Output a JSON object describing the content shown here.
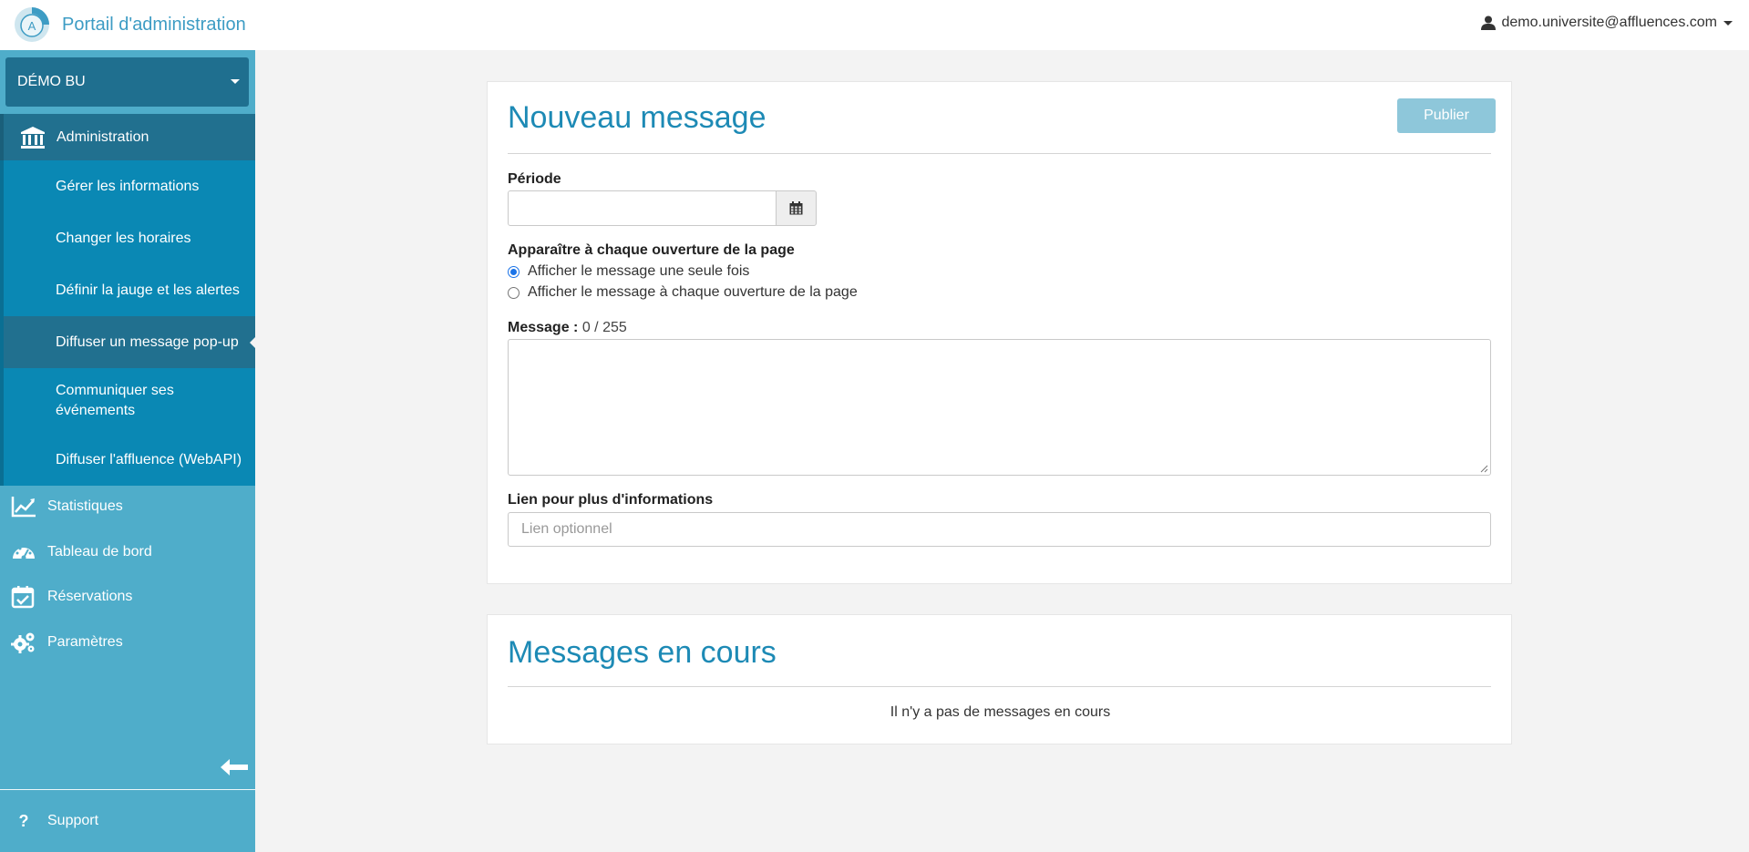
{
  "header": {
    "title": "Portail d'administration",
    "user_email": "demo.universite@affluences.com",
    "logo_letter": "A"
  },
  "sidebar": {
    "site_selector": "DÉMO BU",
    "admin_label": "Administration",
    "admin_items": [
      {
        "label": "Gérer les informations"
      },
      {
        "label": "Changer les horaires"
      },
      {
        "label": "Définir la jauge et les alertes"
      },
      {
        "label": "Diffuser un message pop-up",
        "active": true
      },
      {
        "label": "Communiquer ses événements"
      },
      {
        "label": "Diffuser l'affluence (WebAPI)"
      }
    ],
    "nav_items": [
      {
        "label": "Statistiques",
        "icon": "chart-line-icon"
      },
      {
        "label": "Tableau de bord",
        "icon": "dashboard-icon"
      },
      {
        "label": "Réservations",
        "icon": "calendar-check-icon"
      },
      {
        "label": "Paramètres",
        "icon": "gears-icon"
      }
    ],
    "support_label": "Support"
  },
  "new_message": {
    "title": "Nouveau message",
    "publish_label": "Publier",
    "period_label": "Période",
    "display_label": "Apparaître à chaque ouverture de la page",
    "radio_once": "Afficher le message une seule fois",
    "radio_every": "Afficher le message à chaque ouverture de la page",
    "message_label": "Message :",
    "message_count": "0 / 255",
    "link_label": "Lien pour plus d'informations",
    "link_placeholder": "Lien optionnel"
  },
  "current_messages": {
    "title": "Messages en cours",
    "empty_text": "Il n'y a pas de messages en cours"
  },
  "colors": {
    "brand": "#3d9cc4",
    "sidebar": "#4fadca",
    "submenu": "#0a88b4",
    "active": "#21708f",
    "title": "#1d8ab5",
    "publish": "#8ec7da"
  }
}
